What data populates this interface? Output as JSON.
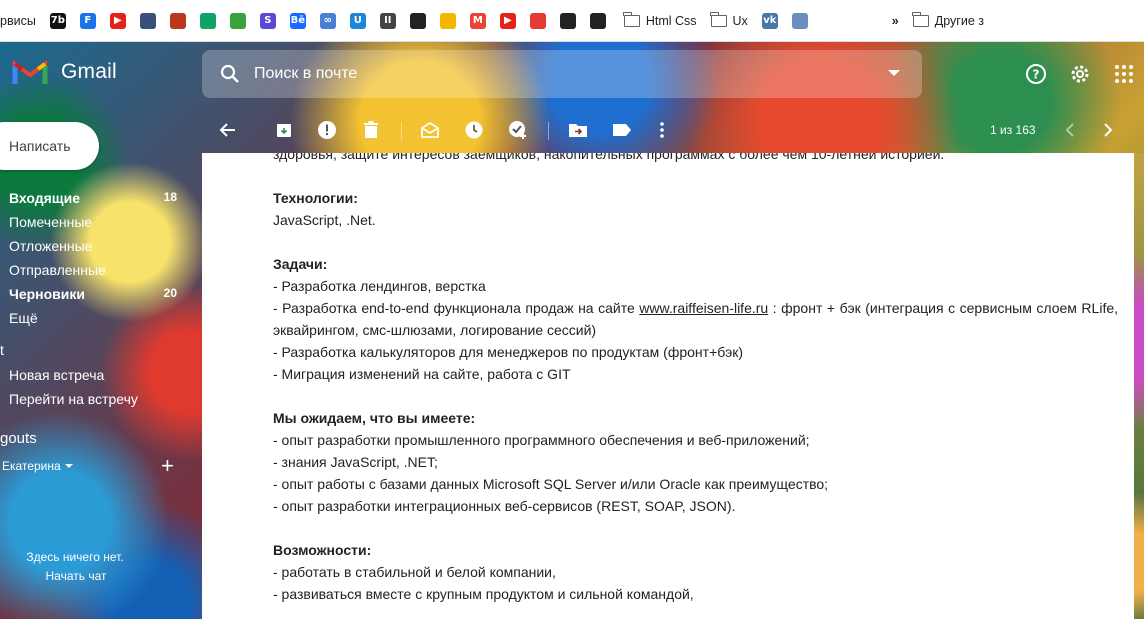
{
  "bookmarks": {
    "first_partial": "рвисы",
    "items": [
      {
        "name": "7b",
        "label": "7b",
        "color": "#111111"
      },
      {
        "name": "f-circle",
        "label": "F",
        "color": "#1a73e8"
      },
      {
        "name": "youtube",
        "label": "▶",
        "color": "#e62117"
      },
      {
        "name": "folder-dark",
        "label": "",
        "color": "#38507a"
      },
      {
        "name": "grid-red",
        "label": "",
        "color": "#b83a1b"
      },
      {
        "name": "drop",
        "label": "",
        "color": "#0fa36a"
      },
      {
        "name": "leaf",
        "label": "",
        "color": "#3aa23a"
      },
      {
        "name": "s-purple",
        "label": "S",
        "color": "#5a48d8"
      },
      {
        "name": "behance",
        "label": "Bē",
        "color": "#1769ff"
      },
      {
        "name": "link",
        "label": "∞",
        "color": "#4a7fd3"
      },
      {
        "name": "u-blue",
        "label": "U",
        "color": "#1b87d8"
      },
      {
        "name": "pause",
        "label": "II",
        "color": "#444444"
      },
      {
        "name": "globe1",
        "label": "",
        "color": "#222222"
      },
      {
        "name": "drive",
        "label": "",
        "color": "#f4b400"
      },
      {
        "name": "gmail",
        "label": "M",
        "color": "#ea4335"
      },
      {
        "name": "youtube2",
        "label": "▶",
        "color": "#e62117"
      },
      {
        "name": "red-app",
        "label": "",
        "color": "#e53935"
      },
      {
        "name": "globe2",
        "label": "",
        "color": "#222222"
      },
      {
        "name": "globe3",
        "label": "",
        "color": "#222222"
      }
    ],
    "folders": [
      "Html Css",
      "Ux"
    ],
    "tail_items": [
      {
        "name": "vk",
        "label": "vk",
        "color": "#4a76a8"
      },
      {
        "name": "avatar-app",
        "label": "",
        "color": "#6a8fbf"
      }
    ],
    "more": "»",
    "other": "Другие з"
  },
  "header": {
    "brand": "Gmail",
    "search_placeholder": "Поиск в почте"
  },
  "toolbar": {
    "pager": "1 из 163"
  },
  "nav": {
    "compose": "Написать",
    "items": [
      {
        "label": "Входящие",
        "count": "18",
        "bold": true
      },
      {
        "label": "Помеченные",
        "count": "",
        "bold": false
      },
      {
        "label": "Отложенные",
        "count": "",
        "bold": false
      },
      {
        "label": "Отправленные",
        "count": "",
        "bold": false
      },
      {
        "label": "Черновики",
        "count": "20",
        "bold": true
      },
      {
        "label": "Ещё",
        "count": "",
        "bold": false
      }
    ],
    "meet_partial": "t",
    "meet_new": "Новая встреча",
    "meet_join": "Перейти на встречу",
    "hangouts_partial": "gouts",
    "hangouts_user": "Екатерина",
    "no_chats": "Здесь ничего нет.",
    "start_chat": "Начать чат"
  },
  "mail": {
    "cutoff_line": "здоровья, защите интересов заемщиков, накопительных программах с более чем 10-летней историей.",
    "tech_heading": "Технологии:",
    "tech_value": "JavaScript, .Net.",
    "tasks_heading": "Задачи:",
    "task1": "- Разработка лендингов, верстка",
    "task2_prefix": "- Разработка end-to-end функционала продаж на сайте ",
    "task2_link": "www.raiffeisen-life.ru",
    "task2_suffix": " : фронт + бэк (интеграция с сервисным слоем RLife, эквайрингом, смс-шлюзами, логирование сессий)",
    "task3": "- Разработка калькуляторов для менеджеров по продуктам (фронт+бэк)",
    "task4": "- Миграция изменений на сайте, работа с GIT",
    "expect_heading": "Мы ожидаем, что вы имеете:",
    "expect1": "- опыт разработки промышленного программного обеспечения и веб-приложений;",
    "expect2": "- знания JavaScript, .NET;",
    "expect3": "- опыт работы с базами данных Microsoft SQL Server и/или Oracle как преимущество;",
    "expect4": "- опыт разработки интеграционных веб-сервисов (REST, SOAP, JSON).",
    "opps_heading": "Возможности:",
    "opp1": "- работать в стабильной и белой компании,",
    "opp2": "- развиваться вместе с крупным продуктом и сильной командой,"
  }
}
